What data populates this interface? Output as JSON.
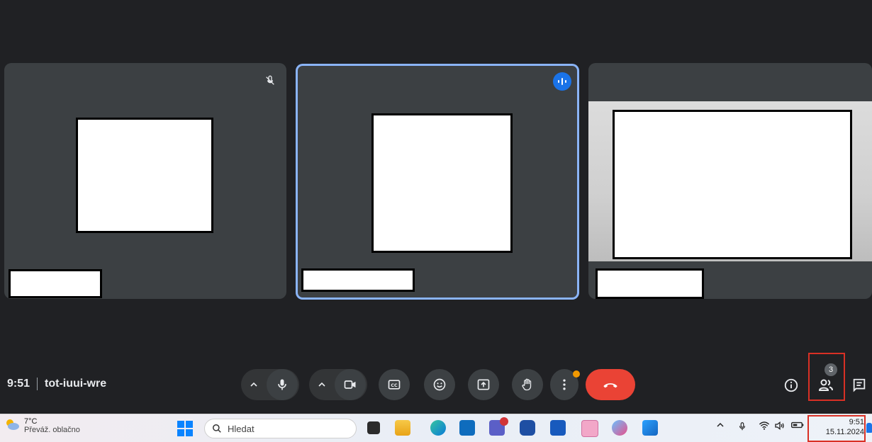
{
  "meeting": {
    "time": "9:51",
    "code": "tot-iuui-wre"
  },
  "tiles": [
    {
      "id": "participant-1",
      "muted": true
    },
    {
      "id": "participant-2",
      "speaking": true,
      "border_color": "#8ab4f8"
    },
    {
      "id": "participant-3",
      "video_on": true
    }
  ],
  "controls": {
    "icons": [
      "microphone-icon",
      "camera-icon",
      "captions-icon",
      "emoji-icon",
      "present-icon",
      "raise-hand-icon",
      "more-options-icon",
      "hang-up-icon"
    ],
    "hangup_color": "#ea4335",
    "more_options_dot_color": "#f29900"
  },
  "side_controls": {
    "people_count": "3",
    "icons": [
      "info-icon",
      "people-icon",
      "chat-icon"
    ]
  },
  "taskbar": {
    "weather_temp": "7°C",
    "weather_desc": "Převáž. oblačno",
    "search_placeholder": "Hledat",
    "clock_time": "9:51",
    "clock_date": "15.11.2024"
  },
  "colors": {
    "meet_bg": "#202124",
    "tile_bg": "#3c4043",
    "highlight": "#d93025"
  }
}
